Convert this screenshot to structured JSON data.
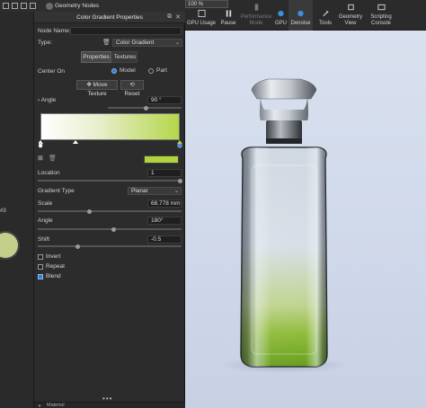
{
  "topbar": {
    "geometry_tab": "Geometry Nodes",
    "zoom": "100 %",
    "buttons": [
      {
        "label": "GPU Usage",
        "icon": "gpu-usage-icon"
      },
      {
        "label": "Pause",
        "icon": "pause-icon"
      },
      {
        "label": "Performance Mode",
        "icon": "performance-icon"
      },
      {
        "label": "GPU",
        "icon": "gpu-icon"
      },
      {
        "label": "Denoise",
        "icon": "denoise-icon"
      },
      {
        "label": "Tools",
        "icon": "tools-icon"
      },
      {
        "label": "Geometry View",
        "icon": "geometry-view-icon"
      },
      {
        "label": "Scripting Console",
        "icon": "scripting-console-icon"
      }
    ]
  },
  "left_strip": {
    "label": "#3"
  },
  "panel": {
    "title": "Color Gradient Properties",
    "node_name_label": "Node Name:",
    "node_name_value": "",
    "type_label": "Type:",
    "type_value": "Color Gradient",
    "tab_properties": "Properties",
    "tab_textures": "Textures",
    "center_on_label": "Center On",
    "center_model": "Model",
    "center_part": "Part",
    "move_texture": "Move Texture",
    "reset": "Reset",
    "angle_label": "Angle",
    "angle_value": "90 °",
    "location_label": "Location",
    "location_value": "1",
    "gradient_type_label": "Gradient Type",
    "gradient_type_value": "Planar",
    "scale_label": "Scale",
    "scale_value": "68.778 mm",
    "angle2_label": "Angle",
    "angle2_value": "180°",
    "shift_label": "Shift",
    "shift_value": "-0.5",
    "invert_label": "Invert",
    "repeat_label": "Repeat",
    "blend_label": "Blend",
    "invert_checked": false,
    "repeat_checked": false,
    "blend_checked": true,
    "gradient_end_color": "#b2d23e"
  },
  "footer": {
    "material_label": "Material"
  }
}
